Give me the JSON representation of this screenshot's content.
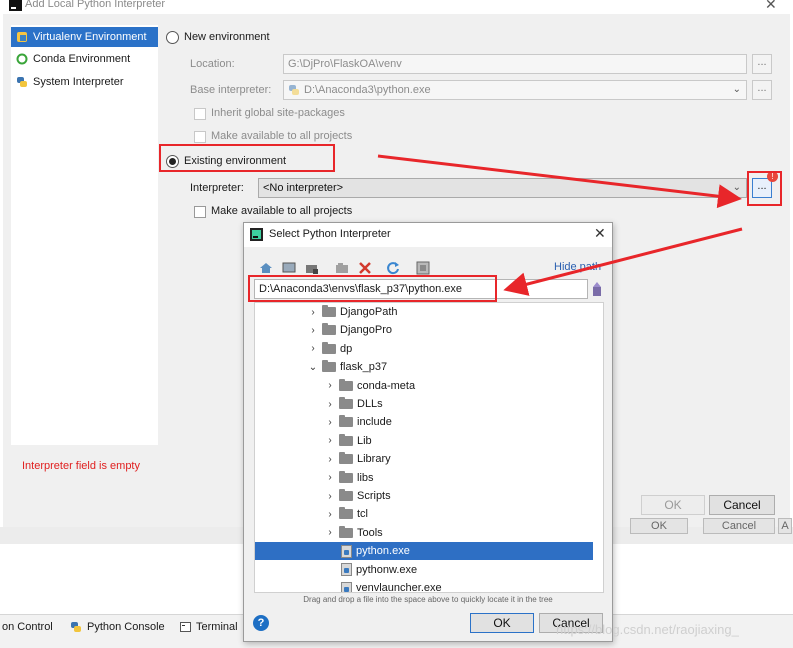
{
  "main_dialog": {
    "title": "Add Local Python Interpreter",
    "left_list": [
      {
        "label": "Virtualenv Environment",
        "icon": "virtualenv-icon",
        "selected": true
      },
      {
        "label": "Conda Environment",
        "icon": "conda-ring-icon",
        "selected": false
      },
      {
        "label": "System Interpreter",
        "icon": "python-logo-icon",
        "selected": false
      }
    ],
    "new_env_label": "New environment",
    "location_label": "Location:",
    "location_value": "G:\\DjPro\\FlaskOA\\venv",
    "base_interp_label": "Base interpreter:",
    "base_interp_value": "D:\\Anaconda3\\python.exe",
    "inherit_label": "Inherit global site-packages",
    "make_available_label": "Make available to all projects",
    "existing_env_label": "Existing environment",
    "interpreter_label": "Interpreter:",
    "interpreter_value": "<No interpreter>",
    "make_available2_label": "Make available to all projects",
    "browse_label": "...",
    "error_text": "Interpreter field is empty",
    "ok_label": "OK",
    "cancel_label": "Cancel",
    "badge_text": "!"
  },
  "background": {
    "ok_label": "OK",
    "cancel_label": "Cancel",
    "apply_label": "A"
  },
  "bottom_toolbar": {
    "items": [
      "on Control",
      "Python Console",
      "Terminal"
    ]
  },
  "select_dialog": {
    "title": "Select Python Interpreter",
    "hide_path_label": "Hide path",
    "path_value": "D:\\Anaconda3\\envs\\flask_p37\\python.exe",
    "tree": [
      {
        "label": "DjangoPath",
        "kind": "folder",
        "indent": 3,
        "expanded": false,
        "selected": false
      },
      {
        "label": "DjangoPro",
        "kind": "folder",
        "indent": 3,
        "expanded": false,
        "selected": false
      },
      {
        "label": "dp",
        "kind": "folder",
        "indent": 3,
        "expanded": false,
        "selected": false
      },
      {
        "label": "flask_p37",
        "kind": "folder",
        "indent": 3,
        "expanded": true,
        "selected": false
      },
      {
        "label": "conda-meta",
        "kind": "folder",
        "indent": 4,
        "expanded": false,
        "selected": false
      },
      {
        "label": "DLLs",
        "kind": "folder",
        "indent": 4,
        "expanded": false,
        "selected": false
      },
      {
        "label": "include",
        "kind": "folder",
        "indent": 4,
        "expanded": false,
        "selected": false
      },
      {
        "label": "Lib",
        "kind": "folder",
        "indent": 4,
        "expanded": false,
        "selected": false
      },
      {
        "label": "Library",
        "kind": "folder",
        "indent": 4,
        "expanded": false,
        "selected": false
      },
      {
        "label": "libs",
        "kind": "folder",
        "indent": 4,
        "expanded": false,
        "selected": false
      },
      {
        "label": "Scripts",
        "kind": "folder",
        "indent": 4,
        "expanded": false,
        "selected": false
      },
      {
        "label": "tcl",
        "kind": "folder",
        "indent": 4,
        "expanded": false,
        "selected": false
      },
      {
        "label": "Tools",
        "kind": "folder",
        "indent": 4,
        "expanded": false,
        "selected": false
      },
      {
        "label": "python.exe",
        "kind": "file",
        "indent": 4,
        "expanded": false,
        "selected": true
      },
      {
        "label": "pythonw.exe",
        "kind": "file",
        "indent": 4,
        "expanded": false,
        "selected": false
      },
      {
        "label": "venvlauncher.exe",
        "kind": "file",
        "indent": 4,
        "expanded": false,
        "selected": false
      }
    ],
    "hint": "Drag and drop a file into the space above to quickly locate it in the tree",
    "ok_label": "OK",
    "cancel_label": "Cancel",
    "help_label": "?"
  },
  "watermark": "https://blog.csdn.net/raojiaxing_",
  "colors": {
    "selection": "#2e6fc4",
    "annotation": "#e8262a",
    "error": "#e02020"
  }
}
